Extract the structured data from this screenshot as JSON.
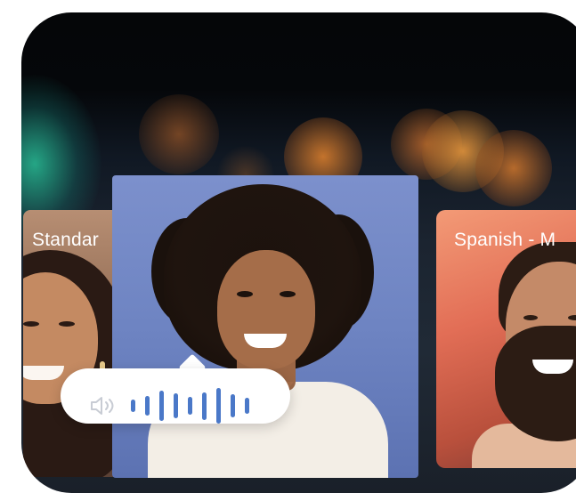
{
  "cards": [
    {
      "label": "Standar",
      "role": "left-speaker"
    },
    {
      "label": null,
      "role": "active-speaker"
    },
    {
      "label": "Spanish - M",
      "role": "right-speaker"
    }
  ],
  "audio_indicator": {
    "icon": "speaker-icon",
    "waveform_levels": [
      0.18,
      0.45,
      0.82,
      0.62,
      0.38,
      0.72,
      1.0,
      0.55,
      0.3
    ],
    "accent_color": "#4a78c8"
  }
}
